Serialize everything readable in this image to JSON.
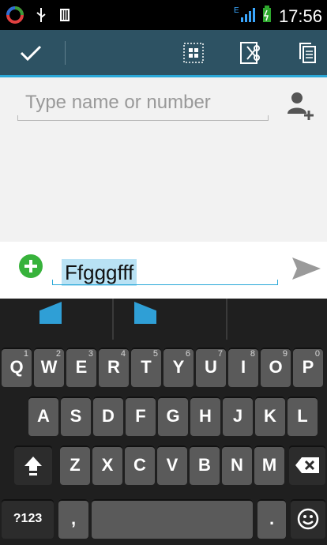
{
  "status_bar": {
    "time": "17:56",
    "network_label": "E"
  },
  "action_bar": {
    "done_icon": "check-icon",
    "grid_icon": "grid-icon",
    "cut_icon": "cut-icon",
    "copy_icon": "copy-icon"
  },
  "recipient": {
    "placeholder": "Type name or number"
  },
  "compose": {
    "message_text": "Ffgggfff"
  },
  "keyboard": {
    "row1": [
      {
        "key": "Q",
        "num": "1"
      },
      {
        "key": "W",
        "num": "2"
      },
      {
        "key": "E",
        "num": "3"
      },
      {
        "key": "R",
        "num": "4"
      },
      {
        "key": "T",
        "num": "5"
      },
      {
        "key": "Y",
        "num": "6"
      },
      {
        "key": "U",
        "num": "7"
      },
      {
        "key": "I",
        "num": "8"
      },
      {
        "key": "O",
        "num": "9"
      },
      {
        "key": "P",
        "num": "0"
      }
    ],
    "row2": [
      "A",
      "S",
      "D",
      "F",
      "G",
      "H",
      "J",
      "K",
      "L"
    ],
    "row3": [
      "Z",
      "X",
      "C",
      "V",
      "B",
      "N",
      "M"
    ],
    "bottom": {
      "sym_label": "?123",
      "comma": ",",
      "period": "."
    }
  }
}
